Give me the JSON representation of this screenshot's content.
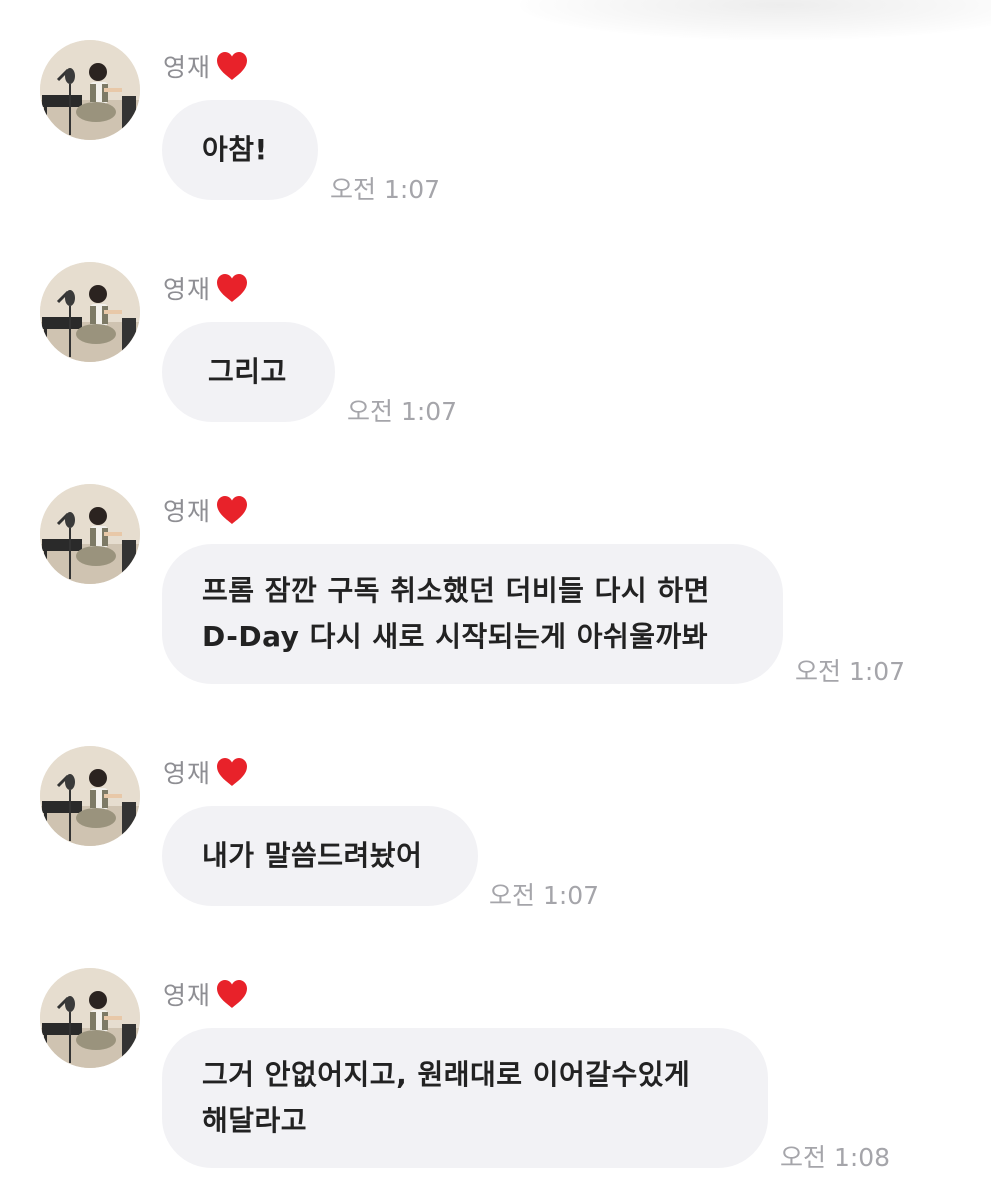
{
  "messages": [
    {
      "sender": "영재",
      "text": "아참!",
      "lines": [],
      "time": "오전 1:07"
    },
    {
      "sender": "영재",
      "text": "그리고",
      "lines": [],
      "time": "오전 1:07"
    },
    {
      "sender": "영재",
      "text": "",
      "lines": [
        "프롬 잠깐 구독 취소했던 더비들 다시 하면",
        "D-Day 다시 새로 시작되는게 아쉬울까봐"
      ],
      "time": "오전 1:07"
    },
    {
      "sender": "영재",
      "text": "내가 말씀드려놨어",
      "lines": [],
      "time": "오전 1:07"
    },
    {
      "sender": "영재",
      "text": "",
      "lines": [
        "그거 안없어지고, 원래대로 이어갈수있게",
        "해달라고"
      ],
      "time": "오전 1:08"
    }
  ],
  "icons": {
    "heart": "heart-icon",
    "avatar": "avatar"
  },
  "colors": {
    "bubble": "#f2f2f5",
    "heart": "#e8222a",
    "timestamp": "#a5a5aa",
    "sender": "#8e8e93"
  }
}
